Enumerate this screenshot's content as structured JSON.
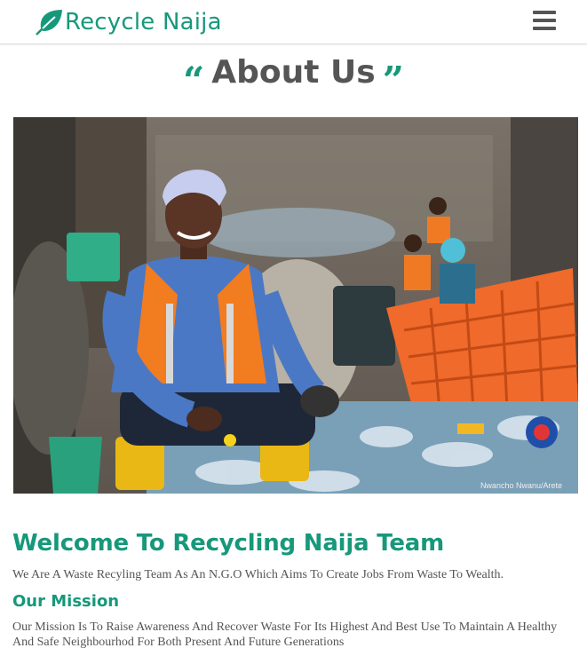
{
  "brand": {
    "name": "Recycle Naija",
    "color": "#17987a"
  },
  "nav": {
    "menu_icon": "hamburger-menu-icon"
  },
  "about": {
    "open_quote": "“",
    "title": "About Us",
    "close_quote": "”"
  },
  "hero": {
    "credit": "Nwancho Nwanu/Arete"
  },
  "welcome": {
    "heading": "Welcome To Recycling Naija Team",
    "text": "We Are A Waste Recyling Team As An N.G.O Which Aims To Create Jobs From Waste To Wealth."
  },
  "mission": {
    "heading": "Our Mission",
    "text": "Our Mission Is To Raise Awareness And Recover Waste For Its Highest And Best Use To Maintain A Healthy And Safe Neighbourhod For Both Present And Future Generations"
  }
}
